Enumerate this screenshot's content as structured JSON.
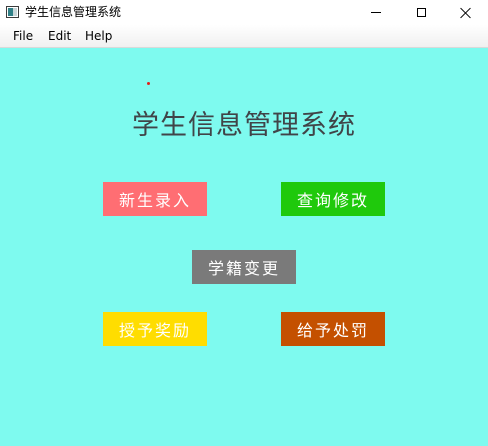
{
  "window": {
    "title": "学生信息管理系统",
    "icon": "app-window-icon",
    "controls": {
      "minimize": "minimize-icon",
      "maximize": "maximize-icon",
      "close": "close-icon"
    }
  },
  "menubar": {
    "items": [
      {
        "label": "File"
      },
      {
        "label": "Edit"
      },
      {
        "label": "Help"
      }
    ]
  },
  "main": {
    "title": "学生信息管理系统",
    "background_color": "#7efaef",
    "buttons": {
      "enroll": {
        "label": "新生录入",
        "color": "#ff6e73"
      },
      "query": {
        "label": "查询修改",
        "color": "#1fc90c"
      },
      "status_change": {
        "label": "学籍变更",
        "color": "#7a7a7a"
      },
      "award": {
        "label": "授予奖励",
        "color": "#ffdd00"
      },
      "punish": {
        "label": "给予处罚",
        "color": "#c45000"
      }
    }
  }
}
